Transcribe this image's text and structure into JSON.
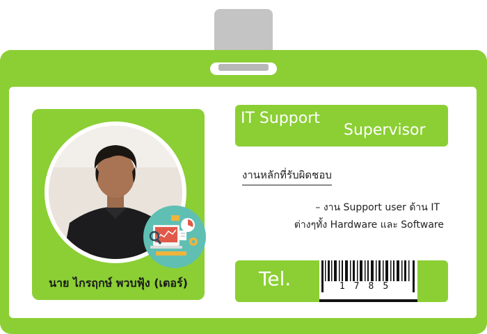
{
  "card": {
    "green": "#8bcf34",
    "title_line1": "IT Support",
    "title_line2": "Supervisor",
    "responsibility_title": "งานหลักที่รับผิดชอบ",
    "responsibility_line1": "– งาน Support user ด้าน IT",
    "responsibility_line2": "ต่างๆทั้ง Hardware และ Software",
    "name": "นาย ไกรฤกษ์ พวบฟุ้ง (เตอร์)",
    "tel_label": "Tel.",
    "tel_number": "1785"
  },
  "icons": [
    "id-card-clip-icon",
    "it-support-icon",
    "barcode-icon"
  ]
}
